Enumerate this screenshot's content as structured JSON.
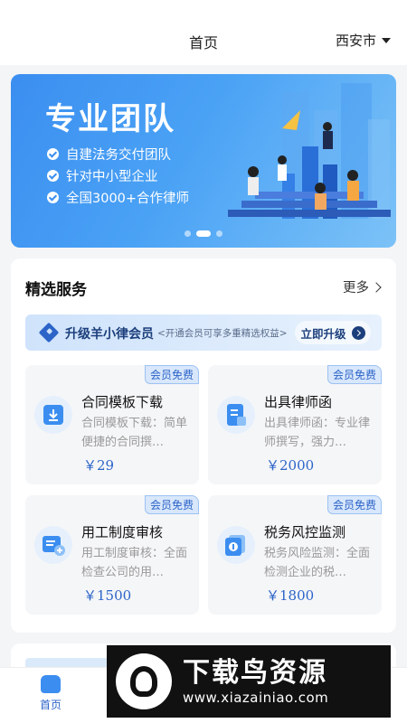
{
  "header": {
    "title": "首页",
    "city": "西安市"
  },
  "banner": {
    "headline": "专业团队",
    "bullets": [
      "自建法务交付团队",
      "针对中小型企业",
      "全国3000+合作律师"
    ]
  },
  "featured": {
    "title": "精选服务",
    "more_label": "更多",
    "member_banner": {
      "title": "升级羊小律会员",
      "subtitle": "<开通会员可享多重精选权益>",
      "button": "立即升级"
    },
    "services": [
      {
        "badge": "会员免费",
        "name": "合同模板下载",
        "desc": "合同模板下载：简单便捷的合同撰…",
        "price": "￥29",
        "icon": "download-icon"
      },
      {
        "badge": "会员免费",
        "name": "出具律师函",
        "desc": "出具律师函：专业律师撰写，强力…",
        "price": "￥2000",
        "icon": "lawyer-letter-icon"
      },
      {
        "badge": "会员免费",
        "name": "用工制度审核",
        "desc": "用工制度审核：全面检查公司的用…",
        "price": "￥1500",
        "icon": "document-review-icon"
      },
      {
        "badge": "会员免费",
        "name": "税务风控监测",
        "desc": "税务风险监测：全面检测企业的税…",
        "price": "￥1800",
        "icon": "tax-monitor-icon"
      }
    ]
  },
  "tabbar": {
    "items": [
      {
        "label": "首页",
        "active": true
      }
    ]
  },
  "watermark": {
    "text": "下载鸟资源",
    "url": "www.xiazainiao.com"
  },
  "colors": {
    "primary": "#3b8ef0",
    "accent": "#2c64c8",
    "background": "#f4f5f7"
  }
}
